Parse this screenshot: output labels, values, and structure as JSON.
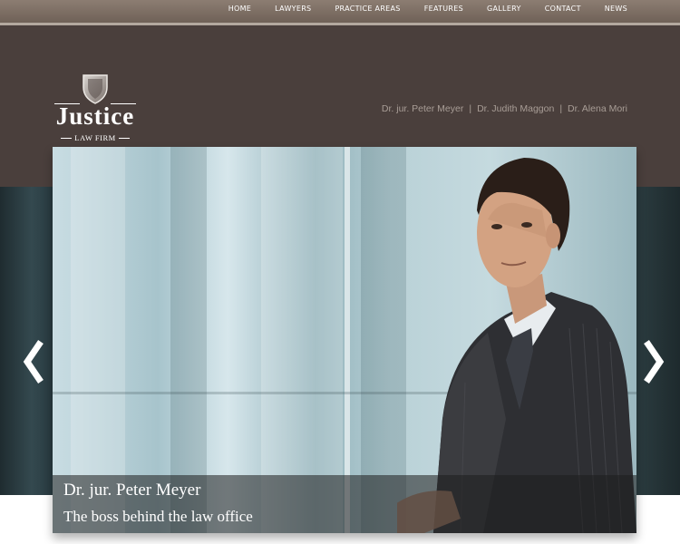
{
  "nav": {
    "items": [
      "HOME",
      "LAWYERS",
      "PRACTICE AREAS",
      "FEATURES",
      "GALLERY",
      "CONTACT",
      "NEWS"
    ]
  },
  "header": {
    "logo_title": "Justice",
    "logo_subtitle": "LAW FIRM",
    "lawyers": [
      "Dr. jur. Peter Meyer",
      "Dr. Judith Maggon",
      "Dr. Alena Mori"
    ],
    "separator": "|"
  },
  "slider": {
    "caption_name": "Dr. jur. Peter Meyer",
    "caption_subtitle": "The boss behind the law office",
    "prev_icon": "chevron-left-icon",
    "next_icon": "chevron-right-icon"
  },
  "colors": {
    "topbar": "#7d6f65",
    "header_bg": "#4a3f3c",
    "lawyers_text": "#a89d96",
    "caption_bg": "#1e1e1e"
  }
}
